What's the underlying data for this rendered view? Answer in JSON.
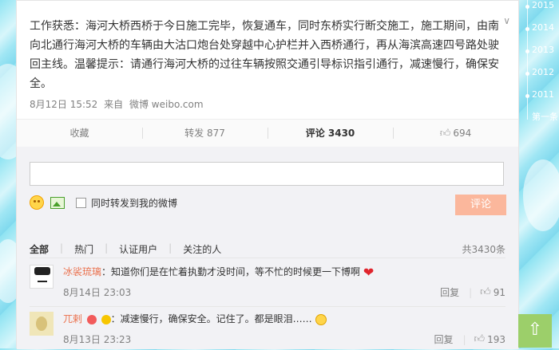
{
  "post": {
    "text": "工作获悉：海河大桥西桥于今日施工完毕，恢复通车，同时东桥实行断交施工，施工期间，由南向北通行海河大桥的车辆由大沽口炮台处穿越中心护栏并入西桥通行，再从海滨高速四号路处驶回主线。温馨提示：请通行海河大桥的过往车辆按照交通引导标识指引通行，减速慢行，确保安全。",
    "date": "8月12日 15:52",
    "source_prefix": "来自",
    "source": "微博 weibo.com"
  },
  "actions": {
    "collect": "收藏",
    "forward": "转发 877",
    "comment": "评论 3430",
    "like_count": "694"
  },
  "composer": {
    "placeholder": "",
    "forward_label": "同时转发到我的微博",
    "submit_label": "评论"
  },
  "tabs": [
    "全部",
    "热门",
    "认证用户",
    "关注的人"
  ],
  "total": "共3430条",
  "comments": [
    {
      "user": "冰裟琉璃",
      "text": "：知道你们是在忙着执勤才没时间，等不忙的时候更一下博啊",
      "date": "8月14日 23:03",
      "reply": "回复",
      "likes": "91"
    },
    {
      "user": "兀剌",
      "text": "：减速慢行，确保安全。记住了。都是眼泪……",
      "date": "8月13日 23:23",
      "reply": "回复",
      "likes": "193"
    }
  ],
  "timeline": {
    "years": [
      "2015",
      "2014",
      "2013",
      "2012",
      "2011"
    ],
    "footer": "第一条"
  },
  "colors": {
    "accent": "#eb7350",
    "submit_bg": "#fbb79c",
    "back_top": "#9ccf6a"
  }
}
